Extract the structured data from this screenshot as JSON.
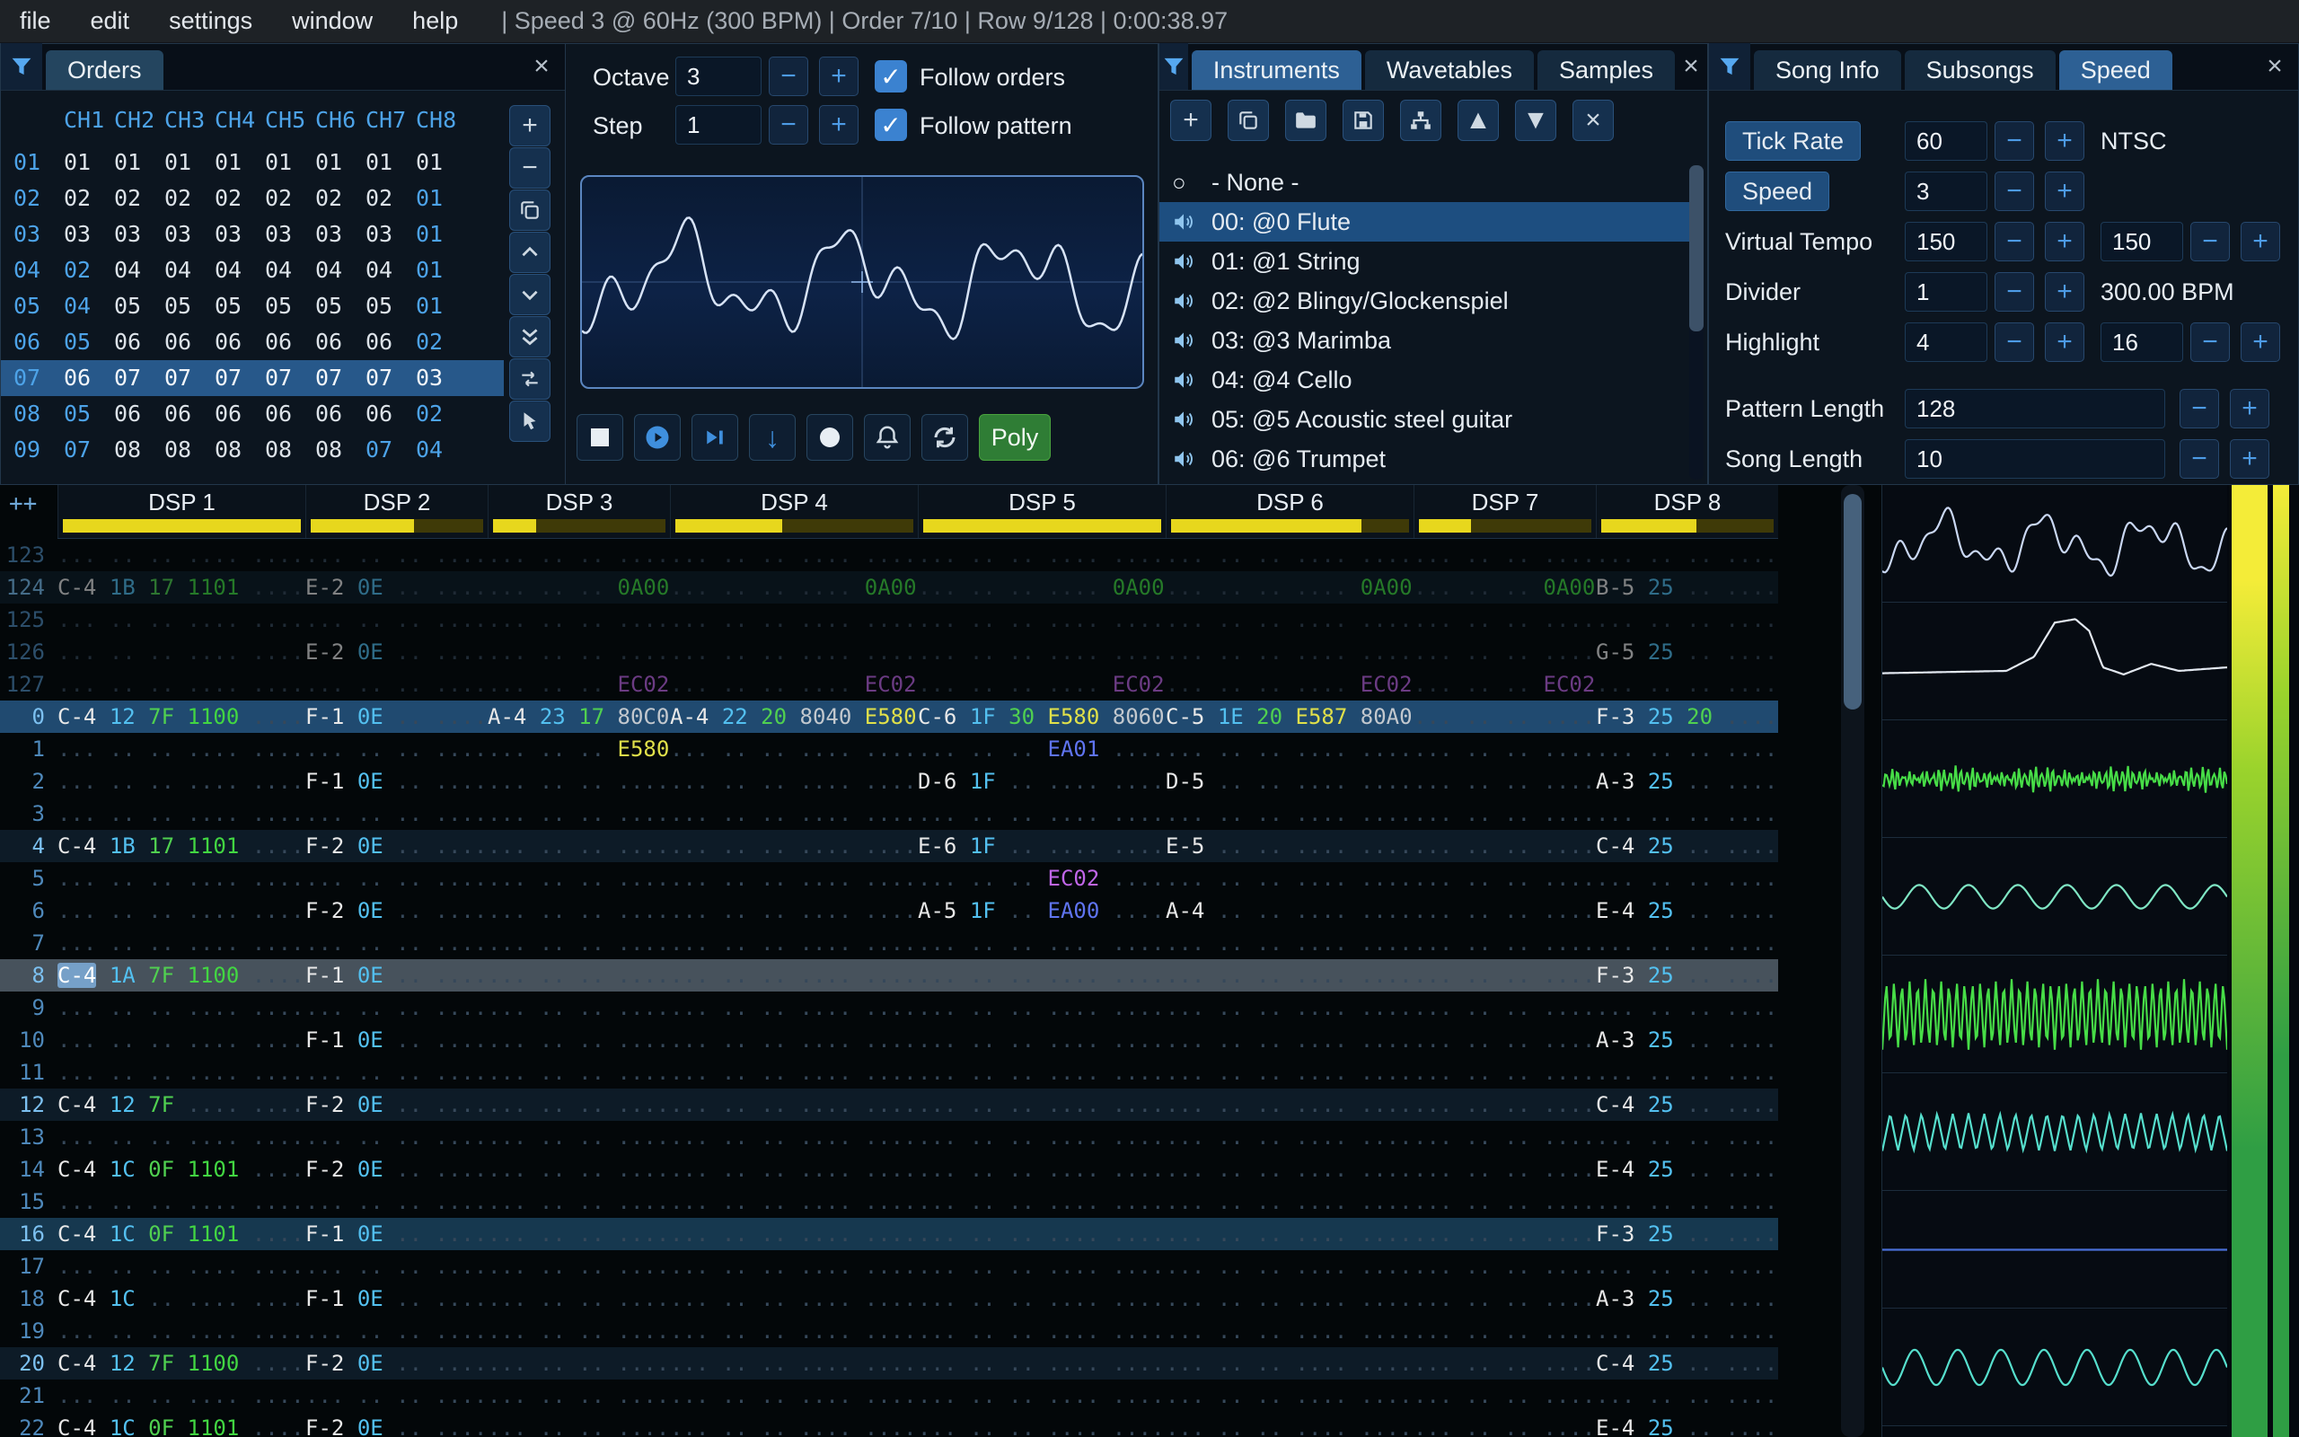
{
  "menu": {
    "items": [
      "file",
      "edit",
      "settings",
      "window",
      "help"
    ],
    "status": "| Speed 3 @ 60Hz (300 BPM) | Order 7/10 | Row 9/128 | 0:00:38.97"
  },
  "glyphs": {
    "plus": "+",
    "minus": "−",
    "close": "×",
    "check": "✓",
    "up_triangle": "▲",
    "down_triangle": "▼",
    "down_arrow": "↓",
    "none_circle": "○"
  },
  "orders": {
    "title": "Orders",
    "channels": [
      "CH1",
      "CH2",
      "CH3",
      "CH4",
      "CH5",
      "CH6",
      "CH7",
      "CH8"
    ],
    "rows": [
      {
        "label": "01",
        "cells": [
          "01",
          "01",
          "01",
          "01",
          "01",
          "01",
          "01",
          "01"
        ],
        "alts": []
      },
      {
        "label": "02",
        "cells": [
          "02",
          "02",
          "02",
          "02",
          "02",
          "02",
          "02",
          "01"
        ],
        "alts": [
          7
        ]
      },
      {
        "label": "03",
        "cells": [
          "03",
          "03",
          "03",
          "03",
          "03",
          "03",
          "03",
          "01"
        ],
        "alts": [
          7
        ]
      },
      {
        "label": "04",
        "cells": [
          "02",
          "04",
          "04",
          "04",
          "04",
          "04",
          "04",
          "01"
        ],
        "alts": [
          0,
          7
        ]
      },
      {
        "label": "05",
        "cells": [
          "04",
          "05",
          "05",
          "05",
          "05",
          "05",
          "05",
          "01"
        ],
        "alts": [
          0,
          7
        ]
      },
      {
        "label": "06",
        "cells": [
          "05",
          "06",
          "06",
          "06",
          "06",
          "06",
          "06",
          "02"
        ],
        "alts": [
          0,
          7
        ]
      },
      {
        "label": "07",
        "cells": [
          "06",
          "07",
          "07",
          "07",
          "07",
          "07",
          "07",
          "03"
        ],
        "selected": true,
        "alts": []
      },
      {
        "label": "08",
        "cells": [
          "05",
          "06",
          "06",
          "06",
          "06",
          "06",
          "06",
          "02"
        ],
        "alts": [
          0,
          7
        ]
      },
      {
        "label": "09",
        "cells": [
          "07",
          "08",
          "08",
          "08",
          "08",
          "08",
          "07",
          "04"
        ],
        "alts": [
          0,
          6,
          7
        ]
      }
    ],
    "toolbar": [
      {
        "name": "order-add-button",
        "icon": "plus",
        "accent": true
      },
      {
        "name": "order-remove-button",
        "icon": "minus",
        "accent": true
      },
      {
        "name": "order-duplicate-button",
        "icon": "clone"
      },
      {
        "name": "order-move-up-button",
        "icon": "chev-up"
      },
      {
        "name": "order-move-down-button",
        "icon": "chev-down"
      },
      {
        "name": "order-duplicate-end-button",
        "icon": "chev-double-down"
      },
      {
        "name": "order-change-all-button",
        "icon": "swap"
      },
      {
        "name": "order-edit-mode-button",
        "icon": "pointer"
      }
    ]
  },
  "controls": {
    "octave_label": "Octave",
    "octave_value": "3",
    "step_label": "Step",
    "step_value": "1",
    "follow_orders_label": "Follow orders",
    "follow_pattern_label": "Follow pattern",
    "poly_label": "Poly"
  },
  "instruments": {
    "tabs": [
      {
        "label": "Instruments",
        "active": true
      },
      {
        "label": "Wavetables"
      },
      {
        "label": "Samples"
      }
    ],
    "toolbar": [
      {
        "name": "instrument-add-button",
        "icon": "plus",
        "accent": true
      },
      {
        "name": "instrument-duplicate-button",
        "icon": "clone"
      },
      {
        "name": "instrument-open-button",
        "icon": "folder"
      },
      {
        "name": "instrument-save-button",
        "icon": "save"
      },
      {
        "name": "instrument-organize-button",
        "icon": "tree"
      },
      {
        "name": "instrument-move-up-button",
        "icon": "up_triangle",
        "accent": true
      },
      {
        "name": "instrument-move-down-button",
        "icon": "down_triangle",
        "accent": true
      },
      {
        "name": "instrument-delete-button",
        "icon": "close",
        "accent": true
      }
    ],
    "items": [
      {
        "label": "- None -",
        "icon": "none"
      },
      {
        "label": "00: @0 Flute",
        "icon": "speaker",
        "selected": true
      },
      {
        "label": "01: @1 String",
        "icon": "speaker"
      },
      {
        "label": "02: @2 Blingy/Glockenspiel",
        "icon": "speaker"
      },
      {
        "label": "03: @3 Marimba",
        "icon": "speaker"
      },
      {
        "label": "04: @4 Cello",
        "icon": "speaker"
      },
      {
        "label": "05: @5 Acoustic steel guitar",
        "icon": "speaker"
      },
      {
        "label": "06: @6 Trumpet",
        "icon": "speaker"
      }
    ]
  },
  "song": {
    "tabs": [
      {
        "label": "Song Info"
      },
      {
        "label": "Subsongs"
      },
      {
        "label": "Speed",
        "active": true
      }
    ],
    "rows": [
      {
        "name": "tick-rate",
        "label": "Tick Rate",
        "label_button": true,
        "controls": [
          {
            "t": "input",
            "v": "60"
          },
          {
            "t": "minus"
          },
          {
            "t": "plus"
          },
          {
            "t": "text",
            "v": "NTSC",
            "gap": true
          }
        ]
      },
      {
        "name": "speed",
        "label": "Speed",
        "label_button": true,
        "controls": [
          {
            "t": "input",
            "v": "3"
          },
          {
            "t": "minus"
          },
          {
            "t": "plus"
          }
        ]
      },
      {
        "name": "virtual-tempo",
        "label": "Virtual Tempo",
        "controls": [
          {
            "t": "input",
            "v": "150"
          },
          {
            "t": "minus"
          },
          {
            "t": "plus"
          },
          {
            "t": "input",
            "v": "150",
            "gap": true
          },
          {
            "t": "minus"
          },
          {
            "t": "plus"
          }
        ]
      },
      {
        "name": "divider",
        "label": "Divider",
        "controls": [
          {
            "t": "input",
            "v": "1"
          },
          {
            "t": "minus"
          },
          {
            "t": "plus"
          },
          {
            "t": "text",
            "v": "300.00 BPM",
            "gap": true
          }
        ]
      },
      {
        "name": "highlight",
        "label": "Highlight",
        "controls": [
          {
            "t": "input",
            "v": "4"
          },
          {
            "t": "minus"
          },
          {
            "t": "plus"
          },
          {
            "t": "input",
            "v": "16",
            "gap": true
          },
          {
            "t": "minus"
          },
          {
            "t": "plus"
          }
        ]
      },
      {
        "name": "pattern-length",
        "label": "Pattern Length",
        "controls": [
          {
            "t": "input",
            "v": "128",
            "wide": true
          },
          {
            "t": "minus"
          },
          {
            "t": "plus"
          }
        ]
      },
      {
        "name": "song-length",
        "label": "Song Length",
        "controls": [
          {
            "t": "input",
            "v": "10",
            "wide": true
          },
          {
            "t": "minus"
          },
          {
            "t": "plus"
          }
        ]
      }
    ]
  },
  "pattern": {
    "corner": "++",
    "channels": [
      {
        "name": "DSP 1",
        "wide": true,
        "meter": 1
      },
      {
        "name": "DSP 2",
        "wide": false,
        "meter": 0.6
      },
      {
        "name": "DSP 3",
        "wide": false,
        "meter": 0.25
      },
      {
        "name": "DSP 4",
        "wide": true,
        "meter": 0.45
      },
      {
        "name": "DSP 5",
        "wide": true,
        "meter": 1
      },
      {
        "name": "DSP 6",
        "wide": true,
        "meter": 0.8
      },
      {
        "name": "DSP 7",
        "wide": false,
        "meter": 0.3
      },
      {
        "name": "DSP 8",
        "wide": false,
        "meter": 0.55
      }
    ],
    "rows": [
      {
        "n": "123",
        "cls": "prev",
        "c": [
          [],
          [],
          [],
          [],
          [],
          [],
          [],
          []
        ]
      },
      {
        "n": "124",
        "cls": "prev hl4",
        "c": [
          [
            "0:C-4",
            "1:1B",
            "2:17",
            "3:1101:fg"
          ],
          [
            "0:E-2",
            "1:0E"
          ],
          [
            "3:0A00:fg"
          ],
          [
            "4:0A00:fg"
          ],
          [
            "4:0A00:fg"
          ],
          [
            "4:0A00:fg"
          ],
          [
            "3:0A00:fg"
          ],
          [
            "0:B-5",
            "1:25"
          ]
        ]
      },
      {
        "n": "125",
        "cls": "prev",
        "c": [
          [],
          [],
          [],
          [],
          [],
          [],
          [],
          []
        ]
      },
      {
        "n": "126",
        "cls": "prev",
        "c": [
          [],
          [
            "0:E-2",
            "1:0E"
          ],
          [],
          [],
          [],
          [],
          [],
          [
            "0:G-5",
            "1:25"
          ]
        ]
      },
      {
        "n": "127",
        "cls": "prev",
        "c": [
          [],
          [],
          [
            "3:EC02:fp"
          ],
          [
            "4:EC02:fp"
          ],
          [
            "4:EC02:fp"
          ],
          [
            "4:EC02:fp"
          ],
          [
            "3:EC02:fp"
          ],
          []
        ]
      },
      {
        "n": "0",
        "cls": "play",
        "c": [
          [
            "0:C-4",
            "1:12",
            "2:7F",
            "3:1100:fg"
          ],
          [
            "0:F-1",
            "1:0E"
          ],
          [
            "0:A-4",
            "1:23",
            "2:17",
            "3:80C0:fw"
          ],
          [
            "0:A-4",
            "1:22",
            "2:20",
            "3:8040:fw",
            "4:E580:fy"
          ],
          [
            "0:C-6",
            "1:1F",
            "2:30",
            "3:E580:fy",
            "4:8060:fw"
          ],
          [
            "0:C-5",
            "1:1E",
            "2:20",
            "3:E587:fy",
            "4:80A0:fw"
          ],
          [],
          [
            "0:F-3",
            "1:25",
            "2:20"
          ]
        ]
      },
      {
        "n": "1",
        "cls": "",
        "c": [
          [],
          [],
          [
            "3:E580:fy"
          ],
          [],
          [
            "3:EA01:fb"
          ],
          [],
          [],
          []
        ]
      },
      {
        "n": "2",
        "cls": "",
        "c": [
          [],
          [
            "0:F-1",
            "1:0E"
          ],
          [],
          [],
          [
            "0:D-6",
            "1:1F"
          ],
          [
            "0:D-5"
          ],
          [],
          [
            "0:A-3",
            "1:25"
          ]
        ]
      },
      {
        "n": "3",
        "cls": "",
        "c": [
          [],
          [],
          [],
          [],
          [],
          [],
          [],
          []
        ]
      },
      {
        "n": "4",
        "cls": "hl4",
        "c": [
          [
            "0:C-4",
            "1:1B",
            "2:17",
            "3:1101:fg"
          ],
          [
            "0:F-2",
            "1:0E"
          ],
          [],
          [],
          [
            "0:E-6",
            "1:1F"
          ],
          [
            "0:E-5"
          ],
          [],
          [
            "0:C-4",
            "1:25"
          ]
        ]
      },
      {
        "n": "5",
        "cls": "",
        "c": [
          [],
          [],
          [],
          [],
          [
            "3:EC02:fp"
          ],
          [],
          [],
          []
        ]
      },
      {
        "n": "6",
        "cls": "",
        "c": [
          [],
          [
            "0:F-2",
            "1:0E"
          ],
          [],
          [],
          [
            "0:A-5",
            "1:1F",
            "3:EA00:fb"
          ],
          [
            "0:A-4"
          ],
          [],
          [
            "0:E-4",
            "1:25"
          ]
        ]
      },
      {
        "n": "7",
        "cls": "",
        "c": [
          [],
          [],
          [],
          [],
          [],
          [],
          [],
          []
        ]
      },
      {
        "n": "8",
        "cls": "currow",
        "c": [
          [
            "0:C-4:n:cur",
            "1:1A",
            "2:7F",
            "3:1100:fg"
          ],
          [
            "0:F-1",
            "1:0E"
          ],
          [],
          [],
          [],
          [],
          [],
          [
            "0:F-3",
            "1:25"
          ]
        ]
      },
      {
        "n": "9",
        "cls": "",
        "c": [
          [],
          [],
          [],
          [],
          [],
          [],
          [],
          []
        ]
      },
      {
        "n": "10",
        "cls": "",
        "c": [
          [],
          [
            "0:F-1",
            "1:0E"
          ],
          [],
          [],
          [],
          [],
          [],
          [
            "0:A-3",
            "1:25"
          ]
        ]
      },
      {
        "n": "11",
        "cls": "",
        "c": [
          [],
          [],
          [],
          [],
          [],
          [],
          [],
          []
        ]
      },
      {
        "n": "12",
        "cls": "hl4",
        "c": [
          [
            "0:C-4",
            "1:12",
            "2:7F"
          ],
          [
            "0:F-2",
            "1:0E"
          ],
          [],
          [],
          [],
          [],
          [],
          [
            "0:C-4",
            "1:25"
          ]
        ]
      },
      {
        "n": "13",
        "cls": "",
        "c": [
          [],
          [],
          [],
          [],
          [],
          [],
          [],
          []
        ]
      },
      {
        "n": "14",
        "cls": "",
        "c": [
          [
            "0:C-4",
            "1:1C",
            "2:0F",
            "3:1101:fg"
          ],
          [
            "0:F-2",
            "1:0E"
          ],
          [],
          [],
          [],
          [],
          [],
          [
            "0:E-4",
            "1:25"
          ]
        ]
      },
      {
        "n": "15",
        "cls": "",
        "c": [
          [],
          [],
          [],
          [],
          [],
          [],
          [],
          []
        ]
      },
      {
        "n": "16",
        "cls": "hl16",
        "c": [
          [
            "0:C-4",
            "1:1C",
            "2:0F",
            "3:1101:fg"
          ],
          [
            "0:F-1",
            "1:0E"
          ],
          [],
          [],
          [],
          [],
          [],
          [
            "0:F-3",
            "1:25"
          ]
        ]
      },
      {
        "n": "17",
        "cls": "",
        "c": [
          [],
          [],
          [],
          [],
          [],
          [],
          [],
          []
        ]
      },
      {
        "n": "18",
        "cls": "",
        "c": [
          [
            "0:C-4",
            "1:1C"
          ],
          [
            "0:F-1",
            "1:0E"
          ],
          [],
          [],
          [],
          [],
          [],
          [
            "0:A-3",
            "1:25"
          ]
        ]
      },
      {
        "n": "19",
        "cls": "",
        "c": [
          [],
          [],
          [],
          [],
          [],
          [],
          [],
          []
        ]
      },
      {
        "n": "20",
        "cls": "hl4",
        "c": [
          [
            "0:C-4",
            "1:12",
            "2:7F",
            "3:1100:fg"
          ],
          [
            "0:F-2",
            "1:0E"
          ],
          [],
          [],
          [],
          [],
          [],
          [
            "0:C-4",
            "1:25"
          ]
        ]
      },
      {
        "n": "21",
        "cls": "",
        "c": [
          [],
          [],
          [],
          [],
          [],
          [],
          [],
          []
        ]
      },
      {
        "n": "22",
        "cls": "",
        "c": [
          [
            "0:C-4",
            "1:1C",
            "2:0F",
            "3:1101:fg"
          ],
          [
            "0:F-2",
            "1:0E"
          ],
          [],
          [],
          [],
          [],
          [],
          [
            "0:E-4",
            "1:25"
          ]
        ]
      }
    ]
  },
  "scopes": [
    {
      "name": "channel-scope-1",
      "color": "#c9d7f2",
      "kind": "complex",
      "amp": 0.3
    },
    {
      "name": "channel-scope-2",
      "color": "#e2e8f0",
      "kind": "pulse",
      "amp": 1
    },
    {
      "name": "channel-scope-3",
      "color": "#47dd47",
      "kind": "noise",
      "amp": 0.09,
      "f": 60
    },
    {
      "name": "channel-scope-4",
      "color": "#7fe6c4",
      "kind": "sine",
      "amp": 0.1,
      "f": 7
    },
    {
      "name": "channel-scope-5",
      "color": "#47dd47",
      "kind": "tri",
      "amp": 0.3,
      "f": 44
    },
    {
      "name": "channel-scope-6",
      "color": "#56dfcd",
      "kind": "tri",
      "amp": 0.16,
      "f": 22
    },
    {
      "name": "channel-scope-7",
      "color": "#4a6fd8",
      "kind": "flat",
      "amp": 0
    },
    {
      "name": "channel-scope-8",
      "color": "#56dfcd",
      "kind": "sine",
      "amp": 0.15,
      "f": 8
    }
  ],
  "meter": {
    "top_color": "#f4ec38",
    "mid_color": "#9ad32c",
    "bottom_color": "#2f9e44"
  }
}
